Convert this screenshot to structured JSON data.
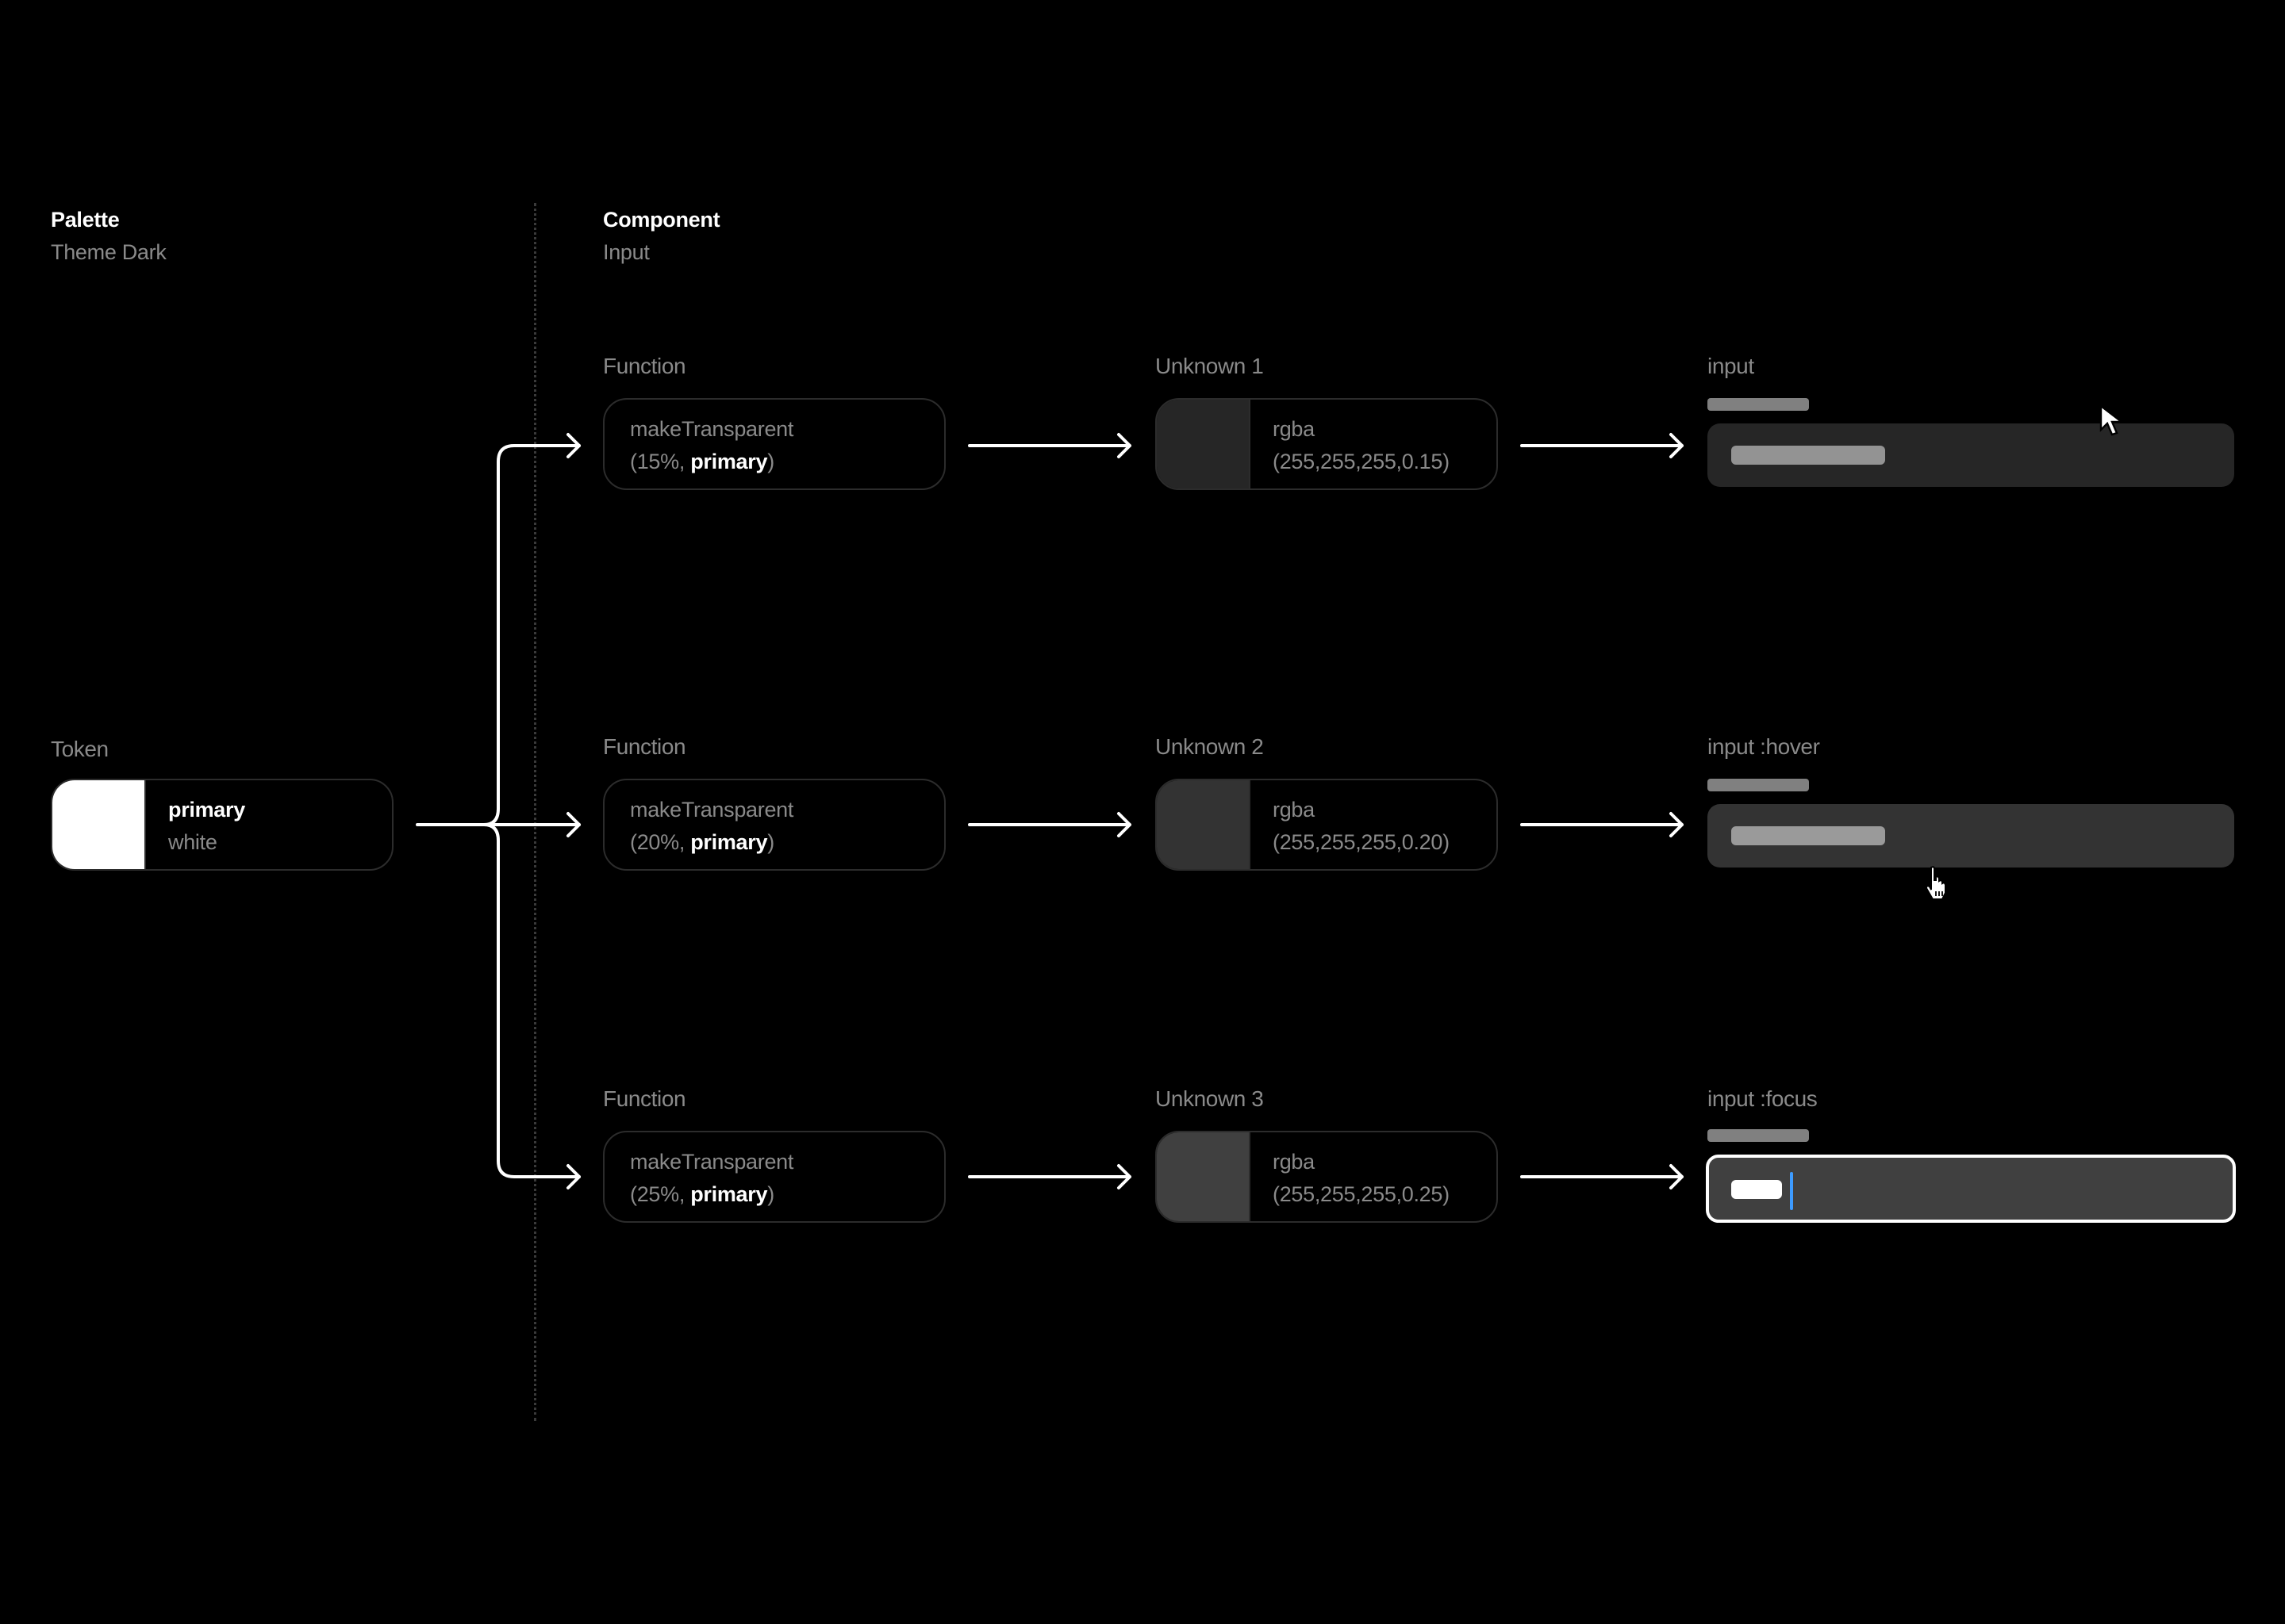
{
  "palette": {
    "title": "Palette",
    "subtitle": "Theme Dark"
  },
  "component": {
    "title": "Component",
    "subtitle": "Input"
  },
  "token": {
    "label": "Token",
    "name": "primary",
    "value": "white",
    "swatch_color": "#ffffff"
  },
  "rows": [
    {
      "function_label": "Function",
      "function_name": "makeTransparent",
      "function_args_prefix": "(15%, ",
      "function_args_token": "primary",
      "function_args_suffix": ")",
      "unknown_label": "Unknown 1",
      "rgba_name": "rgba",
      "rgba_value": "(255,255,255,0.15)",
      "swatch_color": "#262626",
      "state_label": "input",
      "input_bg": "#262626",
      "text_placeholder_color": "#939393"
    },
    {
      "function_label": "Function",
      "function_name": "makeTransparent",
      "function_args_prefix": "(20%, ",
      "function_args_token": "primary",
      "function_args_suffix": ")",
      "unknown_label": "Unknown 2",
      "rgba_name": "rgba",
      "rgba_value": "(255,255,255,0.20)",
      "swatch_color": "#333333",
      "state_label": "input :hover",
      "input_bg": "#333333",
      "text_placeholder_color": "#9a9a9a"
    },
    {
      "function_label": "Function",
      "function_name": "makeTransparent",
      "function_args_prefix": "(25%, ",
      "function_args_token": "primary",
      "function_args_suffix": ")",
      "unknown_label": "Unknown 3",
      "rgba_name": "rgba",
      "rgba_value": "(255,255,255,0.25)",
      "swatch_color": "#404040",
      "state_label": "input :focus",
      "input_bg": "#404040",
      "text_placeholder_color": "#ffffff",
      "focus_border_color": "#ffffff",
      "caret_color": "#3d9bff"
    }
  ],
  "cursors": {
    "pointer": "arrow-cursor",
    "hover": "hand-cursor"
  }
}
